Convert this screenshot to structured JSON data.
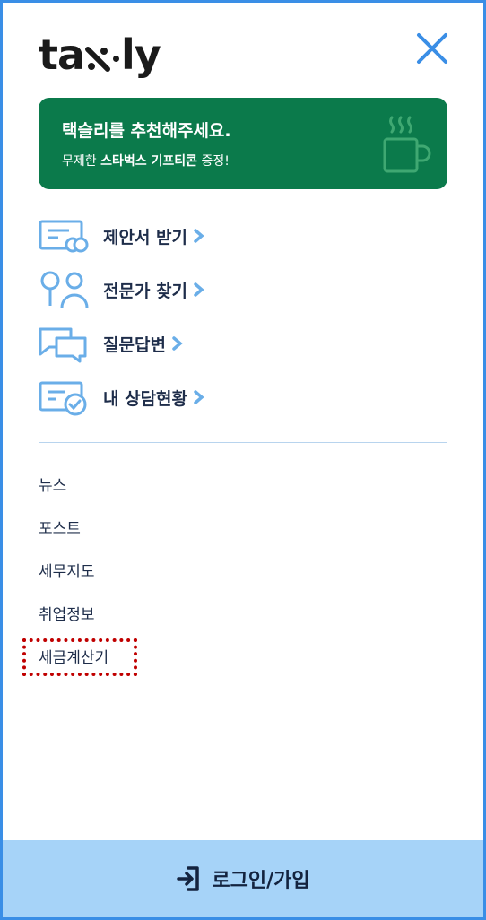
{
  "header": {
    "logo_left": "ta",
    "logo_right": "ly",
    "close_icon": "close-icon"
  },
  "promo": {
    "title": "택슬리를 추천해주세요.",
    "sub_prefix": "무제한 ",
    "sub_bold": "스타벅스 기프티콘",
    "sub_suffix": " 증정!",
    "icon": "coffee-cup-icon",
    "bg_color": "#0b7a4b"
  },
  "menu": [
    {
      "label": "제안서 받기",
      "icon": "proposal-icon"
    },
    {
      "label": "전문가 찾기",
      "icon": "experts-icon"
    },
    {
      "label": "질문답변",
      "icon": "chat-bubbles-icon"
    },
    {
      "label": "내 상담현황",
      "icon": "consult-status-icon"
    }
  ],
  "links": [
    {
      "label": "뉴스"
    },
    {
      "label": "포스트"
    },
    {
      "label": "세무지도"
    },
    {
      "label": "취업정보"
    },
    {
      "label": "세금계산기"
    }
  ],
  "footer": {
    "label": "로그인/가입",
    "icon": "login-icon",
    "bg_color": "#a6d3f8"
  },
  "colors": {
    "accent_blue": "#3a8ee6",
    "icon_blue": "#6aaee8",
    "highlight_red": "#c00000"
  }
}
